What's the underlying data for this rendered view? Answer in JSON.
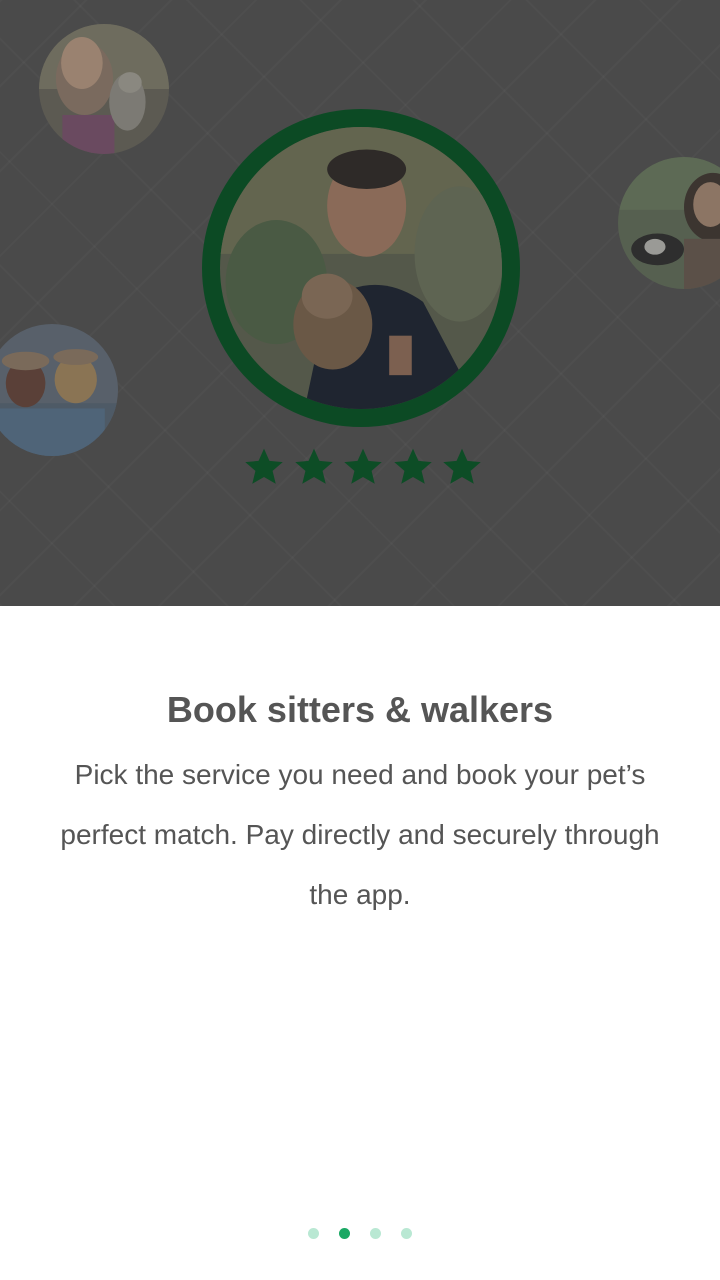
{
  "onboarding": {
    "title": "Book sitters & walkers",
    "description": "Pick the service you need and book your pet’s perfect match. Pay directly and securely through the app.",
    "rating": 5,
    "pager": {
      "total": 4,
      "active_index": 1
    }
  },
  "colors": {
    "hero_background": "#4a4a4a",
    "ring": "#0c4a24",
    "stars": "#0d4d26",
    "text": "#555555",
    "dot_active": "#1aa864",
    "dot_inactive": "#b9e8d3"
  }
}
